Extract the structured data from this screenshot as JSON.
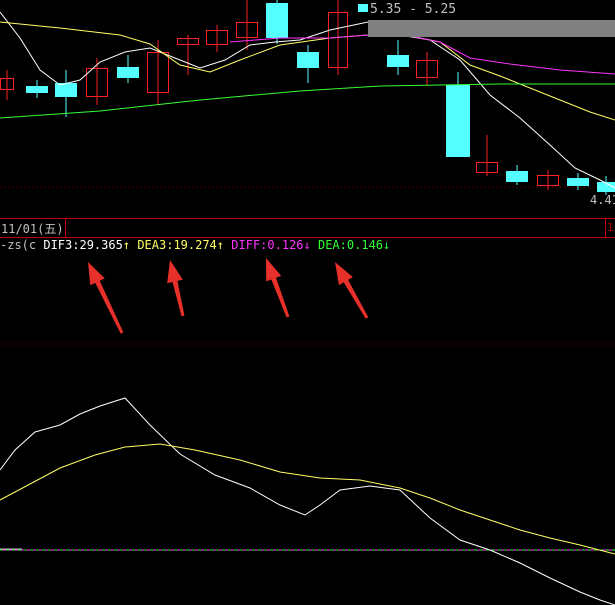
{
  "price_chart": {
    "range_label": "5.35 - 5.25",
    "low_price_label": "4.41",
    "colors": {
      "up_candle": "#ff2020",
      "down_candle": "#54ffff",
      "ma_white": "#ffffff",
      "ma_yellow": "#ffff66",
      "ma_magenta": "#ff33ff",
      "ma_green": "#33ff33",
      "grid_dots": "#800000"
    }
  },
  "date_bar": {
    "date_label": "11/01(五)",
    "right_marker": "1"
  },
  "legend": {
    "prefix": "-zs(c",
    "dif3_label": "DIF3:",
    "dif3_value": "29.365",
    "dif3_arrow": "↑",
    "dea3_label": "DEA3:",
    "dea3_value": "19.274",
    "dea3_arrow": "↑",
    "diff_label": "DIFF:",
    "diff_value": "0.126",
    "diff_arrow": "↓",
    "dea_label": "DEA:",
    "dea_value": "0.146",
    "dea_arrow": "↓"
  },
  "annotations": {
    "arrow_color": "#e8302a",
    "arrow_count": 4
  }
}
